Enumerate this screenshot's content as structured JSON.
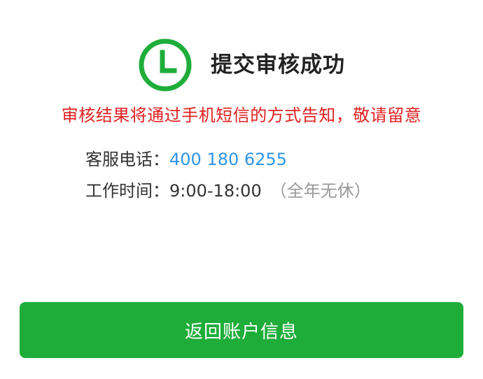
{
  "status": {
    "icon": "clock-icon",
    "title": "提交审核成功",
    "color": "#1fad3a"
  },
  "notice": {
    "text": "审核结果将通过手机短信的方式告知，敬请留意",
    "color": "#e02020"
  },
  "contact": {
    "phone_label": "客服电话：",
    "phone_number": "400 180 6255",
    "hours_label": "工作时间：",
    "hours_value": "9:00-18:00",
    "hours_note": "（全年无休）"
  },
  "actions": {
    "return_label": "返回账户信息"
  }
}
